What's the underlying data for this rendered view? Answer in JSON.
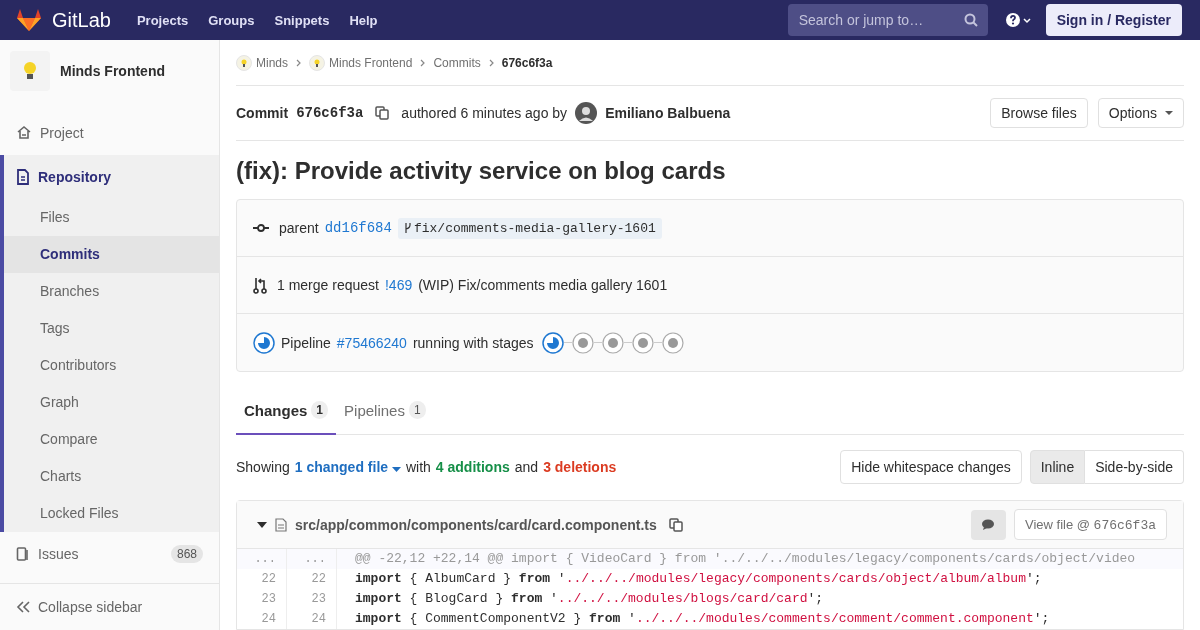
{
  "navbar": {
    "brand": "GitLab",
    "links": [
      "Projects",
      "Groups",
      "Snippets",
      "Help"
    ],
    "search": {
      "placeholder": "Search or jump to…"
    },
    "sign_in": "Sign in / Register"
  },
  "sidebar": {
    "project_name": "Minds Frontend",
    "items": [
      {
        "label": "Project",
        "selected": false
      },
      {
        "label": "Repository",
        "selected": true,
        "children": [
          {
            "label": "Files",
            "selected": false
          },
          {
            "label": "Commits",
            "selected": true
          },
          {
            "label": "Branches",
            "selected": false
          },
          {
            "label": "Tags",
            "selected": false
          },
          {
            "label": "Contributors",
            "selected": false
          },
          {
            "label": "Graph",
            "selected": false
          },
          {
            "label": "Compare",
            "selected": false
          },
          {
            "label": "Charts",
            "selected": false
          },
          {
            "label": "Locked Files",
            "selected": false
          }
        ]
      },
      {
        "label": "Issues",
        "selected": false,
        "badge": "868"
      }
    ],
    "collapse": "Collapse sidebar"
  },
  "breadcrumbs": [
    {
      "label": "Minds",
      "avatar": true
    },
    {
      "label": "Minds Frontend",
      "avatar": true
    },
    {
      "label": "Commits",
      "avatar": false
    },
    {
      "label": "676c6f3a",
      "avatar": false
    }
  ],
  "commit": {
    "label": "Commit",
    "sha": "676c6f3a",
    "authored": "authored 6 minutes ago by",
    "author": "Emiliano Balbuena",
    "buttons": {
      "browse": "Browse files",
      "options": "Options"
    },
    "title": "(fix): Provide activity service on blog cards"
  },
  "info": {
    "parent_label": "parent",
    "parent_sha": "dd16f684",
    "branch": "fix/comments-media-gallery-1601",
    "mr_count": "1 merge request",
    "mr_link": "!469",
    "mr_title": "(WIP) Fix/comments media gallery 1601",
    "pipeline_label": "Pipeline",
    "pipeline_link": "#75466240",
    "pipeline_text": "running with stages",
    "stages": [
      {
        "kind": "running"
      },
      {
        "kind": "pending"
      },
      {
        "kind": "pending"
      },
      {
        "kind": "pending"
      },
      {
        "kind": "pending"
      }
    ]
  },
  "tabs": [
    {
      "label": "Changes",
      "count": "1",
      "selected": true
    },
    {
      "label": "Pipelines",
      "count": "1",
      "selected": false
    }
  ],
  "summary": {
    "showing": "Showing",
    "files": "1 changed file",
    "with": "with",
    "additions": "4 additions",
    "and": "and",
    "deletions": "3 deletions"
  },
  "diff_controls": {
    "whitespace": "Hide whitespace changes",
    "views": [
      {
        "label": "Inline",
        "selected": true
      },
      {
        "label": "Side-by-side",
        "selected": false
      }
    ]
  },
  "file": {
    "path": "src/app/common/components/card/card.component.ts",
    "view_file": "View file @",
    "view_sha": "676c6f3a",
    "lines": [
      {
        "kind": "hunk",
        "old": "...",
        "new": "...",
        "tokens": [
          {
            "kind": "plain",
            "text": "@@ -22,12 +22,14 @@ import { VideoCard } from '../../../modules/legacy/components/cards/object/video"
          }
        ]
      },
      {
        "kind": "context",
        "old": "22",
        "new": "22",
        "tokens": [
          {
            "kind": "keyword",
            "text": "import"
          },
          {
            "kind": "plain",
            "text": " { AlbumCard } "
          },
          {
            "kind": "keyword",
            "text": "from"
          },
          {
            "kind": "plain",
            "text": " '"
          },
          {
            "kind": "string",
            "text": "../../../modules/legacy/components/cards/object/album/album"
          },
          {
            "kind": "plain",
            "text": "';"
          }
        ]
      },
      {
        "kind": "context",
        "old": "23",
        "new": "23",
        "tokens": [
          {
            "kind": "keyword",
            "text": "import"
          },
          {
            "kind": "plain",
            "text": " { BlogCard } "
          },
          {
            "kind": "keyword",
            "text": "from"
          },
          {
            "kind": "plain",
            "text": " '"
          },
          {
            "kind": "string",
            "text": "../../../modules/blogs/card/card"
          },
          {
            "kind": "plain",
            "text": "';"
          }
        ]
      },
      {
        "kind": "context",
        "old": "24",
        "new": "24",
        "tokens": [
          {
            "kind": "keyword",
            "text": "import"
          },
          {
            "kind": "plain",
            "text": " { CommentComponentV2 } "
          },
          {
            "kind": "keyword",
            "text": "from"
          },
          {
            "kind": "plain",
            "text": " '"
          },
          {
            "kind": "string",
            "text": "../../../modules/comments/comment/comment.component"
          },
          {
            "kind": "plain",
            "text": "';"
          }
        ]
      }
    ]
  }
}
